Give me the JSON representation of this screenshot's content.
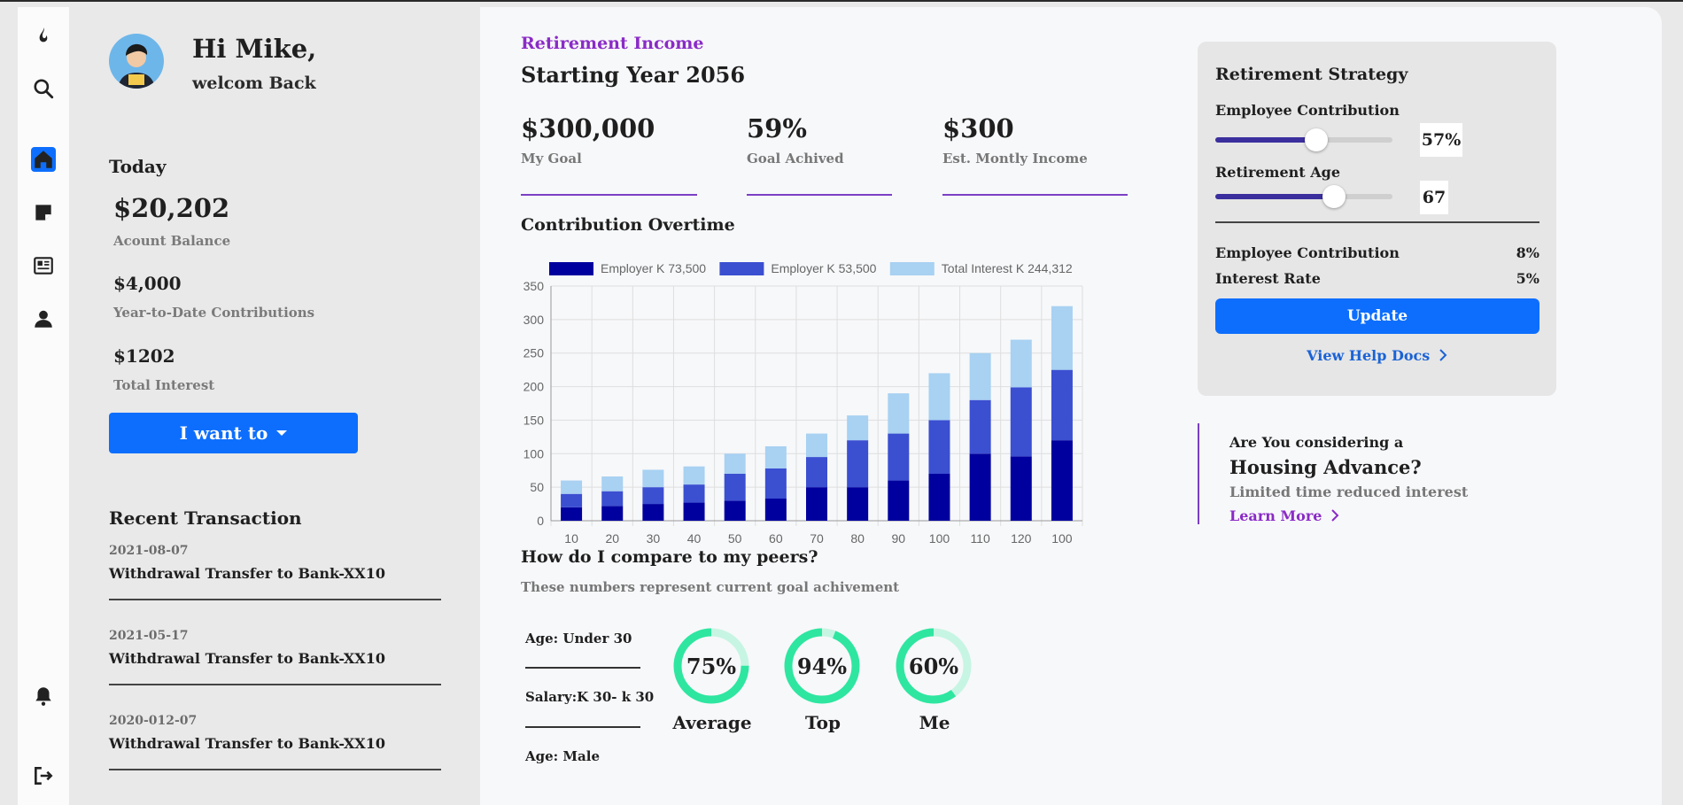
{
  "colors": {
    "primary": "#0d6efd",
    "accent_purple": "#8a2bc6",
    "employer_k": "#00009e",
    "employee_k": "#3b4fd1",
    "total_interest": "#a8d1f2",
    "donut_fill": "#2ee6a0",
    "donut_track": "#c7f5e3"
  },
  "rail": {
    "icons": [
      "flame-icon",
      "search-icon",
      "home-icon",
      "note-icon",
      "newspaper-icon",
      "user-icon",
      "bell-icon",
      "logout-icon"
    ]
  },
  "user": {
    "greeting": "Hi Mike,",
    "welcome": "welcom Back"
  },
  "today": {
    "heading": "Today",
    "stats": [
      {
        "value": "$20,202",
        "label": "Acount Balance"
      },
      {
        "value": "$4,000",
        "label": "Year-to-Date Contributions"
      },
      {
        "value": "$1202",
        "label": "Total Interest"
      }
    ],
    "action_button": "I want to"
  },
  "recent": {
    "heading": "Recent Transaction",
    "items": [
      {
        "date": "2021-08-07",
        "title": "Withdrawal Transfer to Bank-XX10"
      },
      {
        "date": "2021-05-17",
        "title": "Withdrawal Transfer to Bank-XX10"
      },
      {
        "date": "2020-012-07",
        "title": "Withdrawal Transfer to Bank-XX10"
      }
    ]
  },
  "main": {
    "eyebrow": "Retirement Income",
    "title": "Starting Year 2056",
    "kpis": [
      {
        "value": "$300,000",
        "label": "My Goal"
      },
      {
        "value": "59%",
        "label": "Goal Achived"
      },
      {
        "value": "$300",
        "label": "Est. Montly Income"
      }
    ],
    "chart_heading": "Contribution Overtime",
    "compare": {
      "title": "How do I compare to my peers?",
      "subtitle": "These numbers represent current goal achivement",
      "filters": [
        "Age: Under 30",
        "Salary:K 30- k 30",
        "Age: Male"
      ],
      "donuts": [
        {
          "pct": "75%",
          "value": 75,
          "label": "Average"
        },
        {
          "pct": "94%",
          "value": 94,
          "label": "Top"
        },
        {
          "pct": "60%",
          "value": 60,
          "label": "Me"
        }
      ]
    }
  },
  "chart_data": {
    "type": "bar",
    "stacked": true,
    "categories": [
      "10",
      "20",
      "30",
      "40",
      "50",
      "60",
      "70",
      "80",
      "90",
      "100",
      "110",
      "120",
      "100"
    ],
    "series": [
      {
        "name": "Employer K 73,500",
        "values": [
          20,
          22,
          25,
          27,
          30,
          33,
          50,
          50,
          60,
          70,
          100,
          96,
          120
        ]
      },
      {
        "name": "Employer K 53,500",
        "values": [
          20,
          22,
          25,
          27,
          40,
          45,
          45,
          70,
          70,
          80,
          80,
          103,
          105
        ]
      },
      {
        "name": "Total Interest K 244,312",
        "values": [
          20,
          22,
          26,
          27,
          30,
          33,
          35,
          37,
          60,
          70,
          70,
          71,
          95
        ]
      }
    ],
    "yticks": [
      0,
      50,
      100,
      150,
      200,
      250,
      300,
      350
    ],
    "ylim": [
      0,
      350
    ],
    "grid": true,
    "legend": "top"
  },
  "strategy": {
    "title": "Retirement Strategy",
    "employee_contribution_label": "Employee Contribution",
    "employee_contribution_value": "57%",
    "employee_contribution_level": 0.57,
    "retirement_age_label": "Retirement Age",
    "retirement_age_value": "67",
    "retirement_age_level": 0.67,
    "rows": [
      {
        "label": "Employee Contribution",
        "value": "8%"
      },
      {
        "label": "Interest Rate",
        "value": "5%"
      }
    ],
    "update_button": "Update",
    "help_link": "View Help Docs"
  },
  "promo": {
    "line1": "Are You considering a",
    "line2": "Housing Advance?",
    "line3": "Limited time reduced interest",
    "link": "Learn More"
  }
}
